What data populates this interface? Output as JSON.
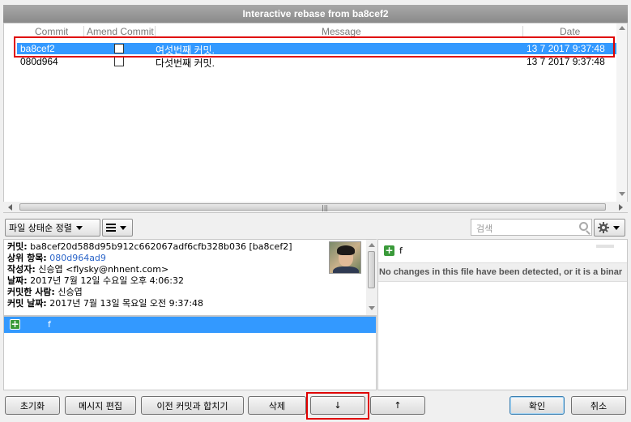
{
  "window": {
    "title": "Interactive rebase from ba8cef2"
  },
  "commit_list": {
    "columns": [
      "Commit",
      "Amend Commit",
      "Message",
      "Date"
    ],
    "rows": [
      {
        "commit": "ba8cef2",
        "amend": false,
        "message": "여섯번째 커밋.",
        "date": "13 7 2017 9:37:48",
        "selected": true
      },
      {
        "commit": "080d964",
        "amend": false,
        "message": "다섯번째 커밋.",
        "date": "13 7 2017 9:37:48",
        "selected": false
      }
    ]
  },
  "toolbar": {
    "sort_label": "파일 상태순 정렬",
    "view_icon": "list-icon",
    "search_placeholder": "검색",
    "settings_icon": "gear-icon"
  },
  "details": {
    "commit_label": "커밋:",
    "commit_value": "ba8cef20d588d95b912c662067adf6cfb328b036 [ba8cef2]",
    "parent_label": "상위 항목:",
    "parent_value": "080d964ad9",
    "author_label": "작성자:",
    "author_value": "신승엽 <flysky@nhnent.com>",
    "date_label": "날짜:",
    "date_value": "2017년 7월 12일 수요일 오후 4:06:32",
    "committer_label": "커밋한 사람:",
    "committer_value": "신승엽",
    "commit_date_label": "커밋 날짜:",
    "commit_date_value": "2017년 7월 13일 목요일 오전 9:37:48"
  },
  "files": [
    {
      "name": "f",
      "status": "added"
    }
  ],
  "diff": {
    "file": "f",
    "message": "No changes in this file have been detected, or it is a binar"
  },
  "buttons": {
    "reset": "초기화",
    "edit_message": "메시지 편집",
    "squash": "이전 커밋과 합치기",
    "delete": "삭제",
    "move_down": "↓",
    "move_up": "↑",
    "ok": "확인",
    "cancel": "취소"
  },
  "colors": {
    "selection": "#3399ff",
    "highlight": "#e00000",
    "added": "#3a9a3a"
  }
}
